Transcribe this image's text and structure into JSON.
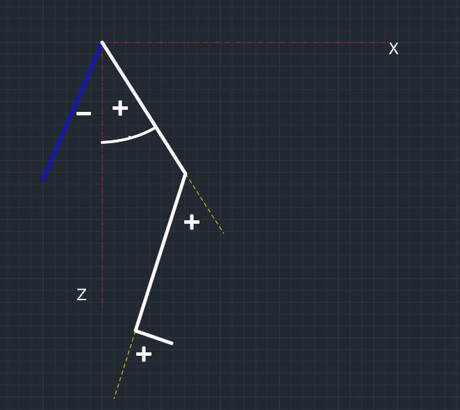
{
  "colors": {
    "background": "#212830",
    "grid_minor": "#2a323c",
    "grid_major": "#313a46",
    "axis": "#b0202a",
    "segment": "#ffffff",
    "negative_segment": "#1010e0",
    "extension": "#d8c81a",
    "label": "#ffffff"
  },
  "axes": {
    "x_label": "X",
    "z_label": "Z"
  },
  "signs": {
    "negative": "−",
    "positive": "+"
  }
}
